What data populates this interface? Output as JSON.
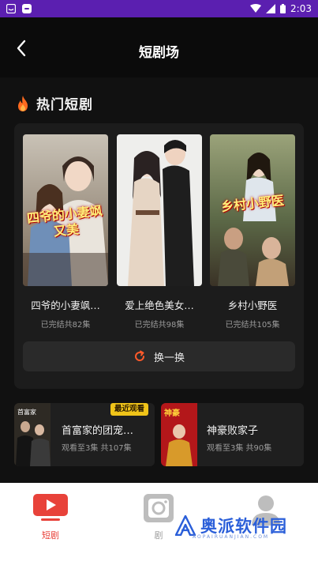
{
  "status_bar": {
    "time": "2:03"
  },
  "header": {
    "title": "短剧场"
  },
  "hot_section": {
    "title": "热门短剧",
    "dramas": [
      {
        "title": "四爷的小妻飒…",
        "meta": "已完结共82集",
        "poster_text": "四爷的小妻飒又美"
      },
      {
        "title": "爱上绝色美女…",
        "meta": "已完结共98集",
        "poster_text": ""
      },
      {
        "title": "乡村小野医",
        "meta": "已完结共105集",
        "poster_text": "乡村小野医"
      }
    ],
    "refresh_label": "换一换"
  },
  "recent": [
    {
      "title": "首富家的团宠…",
      "meta": "观看至3集 共107集",
      "badge": "最近观看",
      "thumb_text": "首富家"
    },
    {
      "title": "神豪败家子",
      "meta": "观看至3集 共90集",
      "badge": "",
      "thumb_text": "神豪"
    }
  ],
  "bottom_nav": {
    "items": [
      {
        "label": "短剧",
        "active": true
      },
      {
        "label": "剧",
        "active": false
      },
      {
        "label": "",
        "active": false
      }
    ]
  },
  "watermark": {
    "text": "奥派软件园",
    "sub": "AOPAIRUANJIAN.COM"
  },
  "colors": {
    "accent": "#e8423a",
    "status_bar": "#5b1fb0",
    "badge": "#f0c419"
  }
}
